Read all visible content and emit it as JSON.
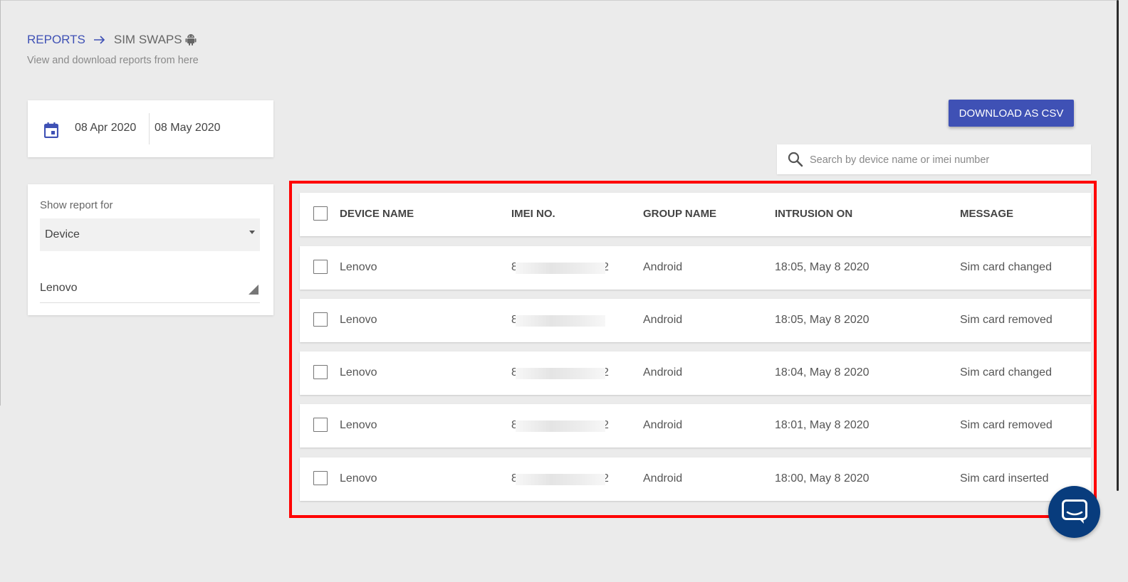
{
  "breadcrumb": {
    "root": "REPORTS",
    "current": "SIM SWAPS",
    "subtitle": "View and download reports from here"
  },
  "date_range": {
    "start": "08 Apr 2020",
    "end": "08 May 2020"
  },
  "filter": {
    "label": "Show report for",
    "selected": "Device",
    "device_value": "Lenovo"
  },
  "toolbar": {
    "download_label": "DOWNLOAD AS CSV",
    "search_placeholder": "Search by device name or imei number"
  },
  "table": {
    "headers": [
      "DEVICE NAME",
      "IMEI NO.",
      "GROUP NAME",
      "INTRUSION ON",
      "MESSAGE"
    ],
    "rows": [
      {
        "device": "Lenovo",
        "imei_start": "8",
        "imei_end": "2",
        "group": "Android",
        "intrusion": "18:05, May 8 2020",
        "message": "Sim card changed"
      },
      {
        "device": "Lenovo",
        "imei_start": "8",
        "imei_end": "",
        "group": "Android",
        "intrusion": "18:05, May 8 2020",
        "message": "Sim card removed"
      },
      {
        "device": "Lenovo",
        "imei_start": "8",
        "imei_end": "2",
        "group": "Android",
        "intrusion": "18:04, May 8 2020",
        "message": "Sim card changed"
      },
      {
        "device": "Lenovo",
        "imei_start": "8",
        "imei_end": "2",
        "group": "Android",
        "intrusion": "18:01, May 8 2020",
        "message": "Sim card removed"
      },
      {
        "device": "Lenovo",
        "imei_start": "8",
        "imei_end": "2",
        "group": "Android",
        "intrusion": "18:00, May 8 2020",
        "message": "Sim card inserted"
      }
    ]
  },
  "colors": {
    "accent": "#3f51b5",
    "highlight": "#ff0000",
    "chat": "#083c7d"
  }
}
